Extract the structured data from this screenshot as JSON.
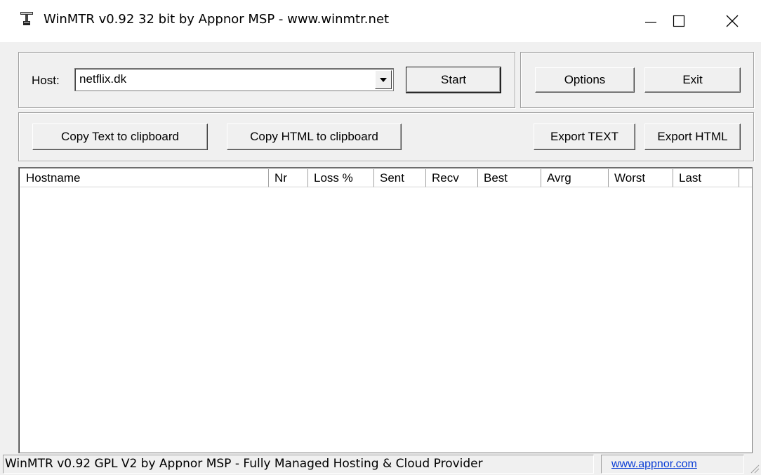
{
  "window": {
    "title": "WinMTR v0.92 32 bit by Appnor MSP - www.winmtr.net",
    "icon": "winmtr-app-icon",
    "controls": [
      "minimize-icon",
      "maximize-icon",
      "close-icon"
    ]
  },
  "host": {
    "label": "Host:",
    "value": "netflix.dk"
  },
  "buttons": {
    "start": "Start",
    "options": "Options",
    "exit": "Exit",
    "copy_text": "Copy Text to clipboard",
    "copy_html": "Copy HTML to clipboard",
    "export_text": "Export TEXT",
    "export_html": "Export HTML"
  },
  "table": {
    "columns": [
      "Hostname",
      "Nr",
      "Loss %",
      "Sent",
      "Recv",
      "Best",
      "Avrg",
      "Worst",
      "Last"
    ],
    "rows": []
  },
  "status": {
    "text": "WinMTR v0.92 GPL V2 by Appnor MSP - Fully Managed Hosting & Cloud Provider",
    "link": "www.appnor.com"
  },
  "colors": {
    "face": "#f0f0f0",
    "link": "#0a3dd6"
  }
}
